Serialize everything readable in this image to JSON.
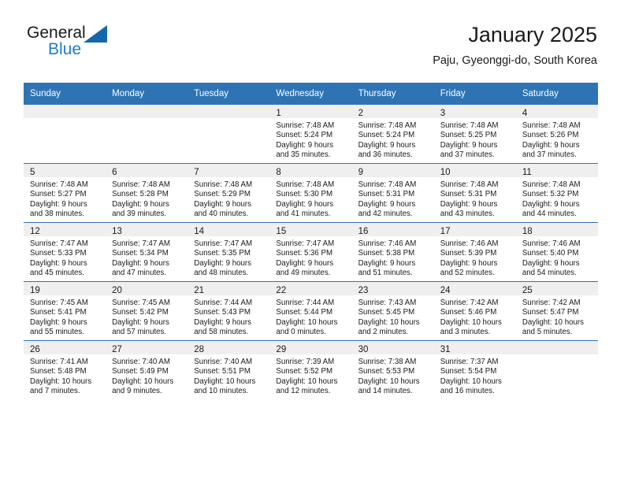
{
  "brand": {
    "name_top": "General",
    "name_bottom": "Blue",
    "accent_color": "#1c7fc4",
    "triangle_color": "#1567ac"
  },
  "header": {
    "title": "January 2025",
    "subtitle": "Paju, Gyeonggi-do, South Korea"
  },
  "theme": {
    "header_band": "#2e74b5",
    "daynum_band": "#efefef",
    "text": "#1a1a1a"
  },
  "weekday_headers": [
    "Sunday",
    "Monday",
    "Tuesday",
    "Wednesday",
    "Thursday",
    "Friday",
    "Saturday"
  ],
  "weeks": [
    [
      {
        "day": "",
        "sunrise": "",
        "sunset": "",
        "daylight_line1": "",
        "daylight_line2": ""
      },
      {
        "day": "",
        "sunrise": "",
        "sunset": "",
        "daylight_line1": "",
        "daylight_line2": ""
      },
      {
        "day": "",
        "sunrise": "",
        "sunset": "",
        "daylight_line1": "",
        "daylight_line2": ""
      },
      {
        "day": "1",
        "sunrise": "Sunrise: 7:48 AM",
        "sunset": "Sunset: 5:24 PM",
        "daylight_line1": "Daylight: 9 hours",
        "daylight_line2": "and 35 minutes."
      },
      {
        "day": "2",
        "sunrise": "Sunrise: 7:48 AM",
        "sunset": "Sunset: 5:24 PM",
        "daylight_line1": "Daylight: 9 hours",
        "daylight_line2": "and 36 minutes."
      },
      {
        "day": "3",
        "sunrise": "Sunrise: 7:48 AM",
        "sunset": "Sunset: 5:25 PM",
        "daylight_line1": "Daylight: 9 hours",
        "daylight_line2": "and 37 minutes."
      },
      {
        "day": "4",
        "sunrise": "Sunrise: 7:48 AM",
        "sunset": "Sunset: 5:26 PM",
        "daylight_line1": "Daylight: 9 hours",
        "daylight_line2": "and 37 minutes."
      }
    ],
    [
      {
        "day": "5",
        "sunrise": "Sunrise: 7:48 AM",
        "sunset": "Sunset: 5:27 PM",
        "daylight_line1": "Daylight: 9 hours",
        "daylight_line2": "and 38 minutes."
      },
      {
        "day": "6",
        "sunrise": "Sunrise: 7:48 AM",
        "sunset": "Sunset: 5:28 PM",
        "daylight_line1": "Daylight: 9 hours",
        "daylight_line2": "and 39 minutes."
      },
      {
        "day": "7",
        "sunrise": "Sunrise: 7:48 AM",
        "sunset": "Sunset: 5:29 PM",
        "daylight_line1": "Daylight: 9 hours",
        "daylight_line2": "and 40 minutes."
      },
      {
        "day": "8",
        "sunrise": "Sunrise: 7:48 AM",
        "sunset": "Sunset: 5:30 PM",
        "daylight_line1": "Daylight: 9 hours",
        "daylight_line2": "and 41 minutes."
      },
      {
        "day": "9",
        "sunrise": "Sunrise: 7:48 AM",
        "sunset": "Sunset: 5:31 PM",
        "daylight_line1": "Daylight: 9 hours",
        "daylight_line2": "and 42 minutes."
      },
      {
        "day": "10",
        "sunrise": "Sunrise: 7:48 AM",
        "sunset": "Sunset: 5:31 PM",
        "daylight_line1": "Daylight: 9 hours",
        "daylight_line2": "and 43 minutes."
      },
      {
        "day": "11",
        "sunrise": "Sunrise: 7:48 AM",
        "sunset": "Sunset: 5:32 PM",
        "daylight_line1": "Daylight: 9 hours",
        "daylight_line2": "and 44 minutes."
      }
    ],
    [
      {
        "day": "12",
        "sunrise": "Sunrise: 7:47 AM",
        "sunset": "Sunset: 5:33 PM",
        "daylight_line1": "Daylight: 9 hours",
        "daylight_line2": "and 45 minutes."
      },
      {
        "day": "13",
        "sunrise": "Sunrise: 7:47 AM",
        "sunset": "Sunset: 5:34 PM",
        "daylight_line1": "Daylight: 9 hours",
        "daylight_line2": "and 47 minutes."
      },
      {
        "day": "14",
        "sunrise": "Sunrise: 7:47 AM",
        "sunset": "Sunset: 5:35 PM",
        "daylight_line1": "Daylight: 9 hours",
        "daylight_line2": "and 48 minutes."
      },
      {
        "day": "15",
        "sunrise": "Sunrise: 7:47 AM",
        "sunset": "Sunset: 5:36 PM",
        "daylight_line1": "Daylight: 9 hours",
        "daylight_line2": "and 49 minutes."
      },
      {
        "day": "16",
        "sunrise": "Sunrise: 7:46 AM",
        "sunset": "Sunset: 5:38 PM",
        "daylight_line1": "Daylight: 9 hours",
        "daylight_line2": "and 51 minutes."
      },
      {
        "day": "17",
        "sunrise": "Sunrise: 7:46 AM",
        "sunset": "Sunset: 5:39 PM",
        "daylight_line1": "Daylight: 9 hours",
        "daylight_line2": "and 52 minutes."
      },
      {
        "day": "18",
        "sunrise": "Sunrise: 7:46 AM",
        "sunset": "Sunset: 5:40 PM",
        "daylight_line1": "Daylight: 9 hours",
        "daylight_line2": "and 54 minutes."
      }
    ],
    [
      {
        "day": "19",
        "sunrise": "Sunrise: 7:45 AM",
        "sunset": "Sunset: 5:41 PM",
        "daylight_line1": "Daylight: 9 hours",
        "daylight_line2": "and 55 minutes."
      },
      {
        "day": "20",
        "sunrise": "Sunrise: 7:45 AM",
        "sunset": "Sunset: 5:42 PM",
        "daylight_line1": "Daylight: 9 hours",
        "daylight_line2": "and 57 minutes."
      },
      {
        "day": "21",
        "sunrise": "Sunrise: 7:44 AM",
        "sunset": "Sunset: 5:43 PM",
        "daylight_line1": "Daylight: 9 hours",
        "daylight_line2": "and 58 minutes."
      },
      {
        "day": "22",
        "sunrise": "Sunrise: 7:44 AM",
        "sunset": "Sunset: 5:44 PM",
        "daylight_line1": "Daylight: 10 hours",
        "daylight_line2": "and 0 minutes."
      },
      {
        "day": "23",
        "sunrise": "Sunrise: 7:43 AM",
        "sunset": "Sunset: 5:45 PM",
        "daylight_line1": "Daylight: 10 hours",
        "daylight_line2": "and 2 minutes."
      },
      {
        "day": "24",
        "sunrise": "Sunrise: 7:42 AM",
        "sunset": "Sunset: 5:46 PM",
        "daylight_line1": "Daylight: 10 hours",
        "daylight_line2": "and 3 minutes."
      },
      {
        "day": "25",
        "sunrise": "Sunrise: 7:42 AM",
        "sunset": "Sunset: 5:47 PM",
        "daylight_line1": "Daylight: 10 hours",
        "daylight_line2": "and 5 minutes."
      }
    ],
    [
      {
        "day": "26",
        "sunrise": "Sunrise: 7:41 AM",
        "sunset": "Sunset: 5:48 PM",
        "daylight_line1": "Daylight: 10 hours",
        "daylight_line2": "and 7 minutes."
      },
      {
        "day": "27",
        "sunrise": "Sunrise: 7:40 AM",
        "sunset": "Sunset: 5:49 PM",
        "daylight_line1": "Daylight: 10 hours",
        "daylight_line2": "and 9 minutes."
      },
      {
        "day": "28",
        "sunrise": "Sunrise: 7:40 AM",
        "sunset": "Sunset: 5:51 PM",
        "daylight_line1": "Daylight: 10 hours",
        "daylight_line2": "and 10 minutes."
      },
      {
        "day": "29",
        "sunrise": "Sunrise: 7:39 AM",
        "sunset": "Sunset: 5:52 PM",
        "daylight_line1": "Daylight: 10 hours",
        "daylight_line2": "and 12 minutes."
      },
      {
        "day": "30",
        "sunrise": "Sunrise: 7:38 AM",
        "sunset": "Sunset: 5:53 PM",
        "daylight_line1": "Daylight: 10 hours",
        "daylight_line2": "and 14 minutes."
      },
      {
        "day": "31",
        "sunrise": "Sunrise: 7:37 AM",
        "sunset": "Sunset: 5:54 PM",
        "daylight_line1": "Daylight: 10 hours",
        "daylight_line2": "and 16 minutes."
      },
      {
        "day": "",
        "sunrise": "",
        "sunset": "",
        "daylight_line1": "",
        "daylight_line2": ""
      }
    ]
  ]
}
